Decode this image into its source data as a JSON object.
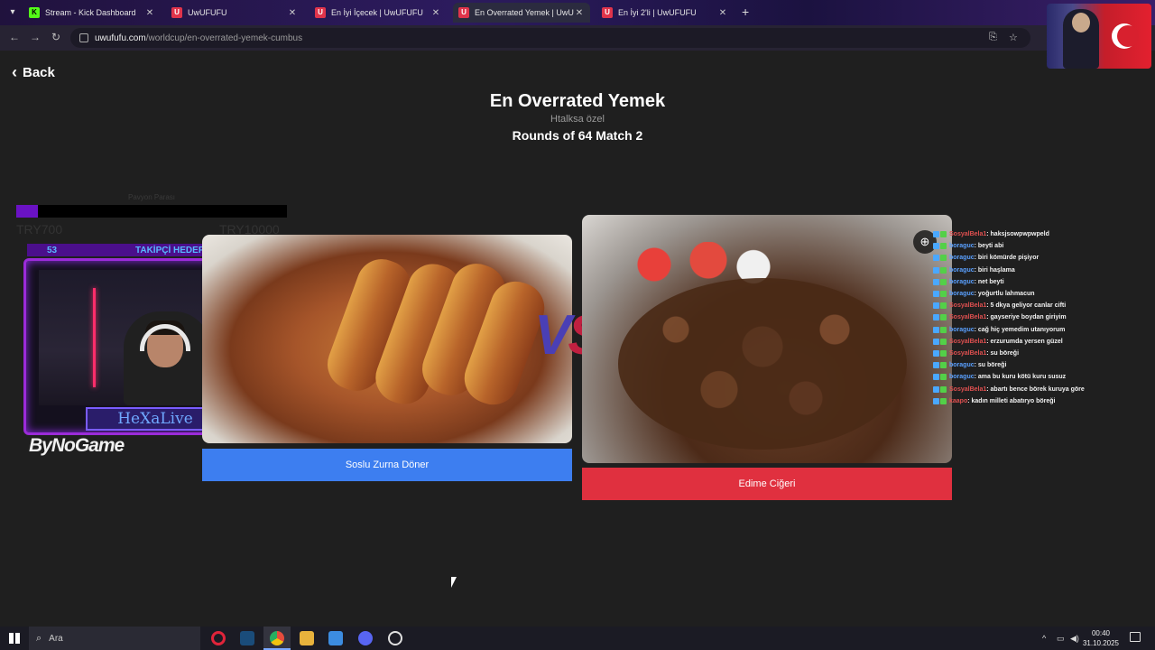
{
  "browser": {
    "tabs": [
      {
        "title": "Stream - Kick Dashboard",
        "favicon": "K",
        "kind": "kick",
        "active": false
      },
      {
        "title": "UwUFUFU",
        "favicon": "U",
        "kind": "uwu",
        "active": false
      },
      {
        "title": "En İyi İçecek | UwUFUFU",
        "favicon": "U",
        "kind": "uwu",
        "active": false
      },
      {
        "title": "En Overrated Yemek | UwUFUFU",
        "favicon": "U",
        "kind": "uwu",
        "active": true
      },
      {
        "title": "En İyi 2'li | UwUFUFU",
        "favicon": "U",
        "kind": "uwu",
        "active": false
      }
    ],
    "url_host": "uwufufu.com",
    "url_path": "/worldcup/en-overrated-yemek-cumbus"
  },
  "page": {
    "back_label": "Back",
    "title": "En Overrated Yemek",
    "subtitle": "Htalksa özel",
    "round": "Rounds of 64 Match 2",
    "vs_v": "V",
    "vs_s": "S",
    "left_choice": "Soslu Zurna Döner",
    "right_choice": "Edime Ciğeri"
  },
  "overlay": {
    "donation": {
      "title": "Pavyon Parası",
      "min_label": "TRY700",
      "max_label": "TRY10000",
      "progress": 0.08,
      "fill_color": "#6a12c4"
    },
    "follow_goal": {
      "count": "53",
      "label": "TAKİPÇİ HEDEFİ"
    },
    "cam_name": "HeXaLive",
    "sponsor": "ByNoGame"
  },
  "chat": [
    {
      "user": "SosyalBela1",
      "color": "#e05050",
      "msg": ": haksjsowpwpwpeld"
    },
    {
      "user": "boraguc",
      "color": "#5aa0ff",
      "msg": ": beyti abi"
    },
    {
      "user": "boraguc",
      "color": "#5aa0ff",
      "msg": ": biri kömürde pişiyor"
    },
    {
      "user": "boraguc",
      "color": "#5aa0ff",
      "msg": ": biri haşlama"
    },
    {
      "user": "boraguc",
      "color": "#5aa0ff",
      "msg": ": net beyti"
    },
    {
      "user": "boraguc",
      "color": "#5aa0ff",
      "msg": ": yoğurtlu lahmacun"
    },
    {
      "user": "SosyalBela1",
      "color": "#e05050",
      "msg": ": 5 dkya geliyor canlar cifti"
    },
    {
      "user": "SosyalBela1",
      "color": "#e05050",
      "msg": ": gayseriye boydan giriyim"
    },
    {
      "user": "boraguc",
      "color": "#5aa0ff",
      "msg": ": cağ hiç yemedim utanıyorum"
    },
    {
      "user": "SosyalBela1",
      "color": "#e05050",
      "msg": ": erzurumda yersen güzel"
    },
    {
      "user": "SosyalBela1",
      "color": "#e05050",
      "msg": ": su böreği"
    },
    {
      "user": "boraguc",
      "color": "#5aa0ff",
      "msg": ": su böreği"
    },
    {
      "user": "boraguc",
      "color": "#5aa0ff",
      "msg": ": ama bu kuru kötü kuru susuz"
    },
    {
      "user": "SosyalBela1",
      "color": "#e05050",
      "msg": ": abartı bence börek kuruya göre"
    },
    {
      "user": "kaapo",
      "color": "#e05050",
      "msg": ": kadın milleti abatıryo böreği"
    }
  ],
  "taskbar": {
    "search_placeholder": "Ara",
    "time": "00:40",
    "date": "31.10.2025"
  }
}
